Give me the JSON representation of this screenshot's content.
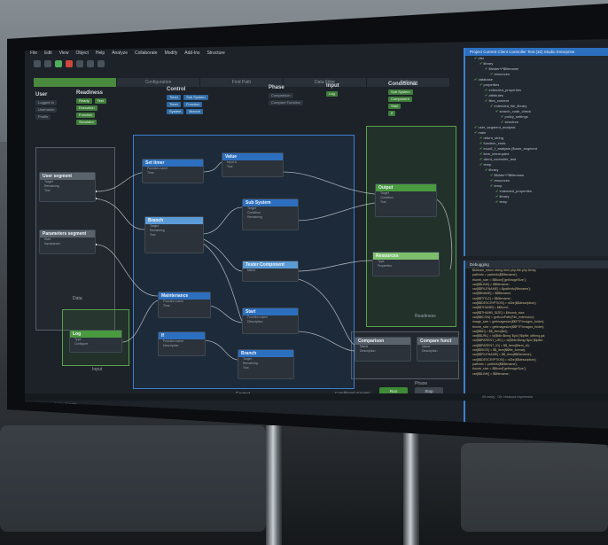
{
  "scene": {
    "description_note": "",
    "menu": [
      "File",
      "Edit",
      "View",
      "Object",
      "Help",
      "Analyze",
      "Collaborate",
      "Modify",
      "Add-Ins",
      "Structure"
    ],
    "tabs": [
      "",
      "Configuration",
      "Find Path",
      "Data Filter",
      "Settings"
    ],
    "groups": [
      {
        "title": "User",
        "chips": [
          "Logged In",
          "Username",
          "Profile"
        ]
      },
      {
        "title": "Readiness",
        "chips": [
          "Ready",
          "Execution",
          "Function",
          "Simulator",
          "Test"
        ]
      },
      {
        "title": "Control",
        "chips": [
          "Timer",
          "Timer",
          "Sub System",
          "Function",
          "System",
          "Branch"
        ]
      },
      {
        "title": "Phase",
        "chips": [
          "Comparison",
          "Compare Function"
        ]
      },
      {
        "title": "Input",
        "chips": [
          "Log"
        ]
      },
      {
        "title": "Conditional",
        "chips": [
          "Sub System",
          "Component",
          "Start",
          "If"
        ]
      }
    ],
    "nodes": {
      "user_segment": {
        "title": "User segment",
        "props": [
          "Target",
          "Remaining",
          "Tool"
        ]
      },
      "param_segment": {
        "title": "Parameters segment",
        "props": [
          "Start",
          "Inputparam"
        ]
      },
      "set_timer": {
        "title": "Set timer",
        "props": [
          "Function name",
          "Time"
        ]
      },
      "value": {
        "title": "Value",
        "props": [
          "Input A",
          "Tool"
        ]
      },
      "branch1": {
        "title": "Branch",
        "props": [
          "Target",
          "Remaining",
          "Tool"
        ]
      },
      "sub_system": {
        "title": "Sub System",
        "props": [
          "Target",
          "Condition",
          "Remaining"
        ]
      },
      "tester": {
        "title": "Tester Component",
        "props": [
          "Name"
        ]
      },
      "maintenance": {
        "title": "Maintenance",
        "props": [
          "Function name",
          "Time"
        ]
      },
      "start": {
        "title": "Start",
        "props": [
          "Function name",
          "Description"
        ]
      },
      "if_node": {
        "title": "If",
        "props": [
          "Function name",
          "Description"
        ]
      },
      "branch2": {
        "title": "Branch",
        "props": [
          "Target",
          "Remaining",
          "Tool"
        ]
      },
      "log": {
        "title": "Log",
        "props": [
          "Type",
          "Configure"
        ]
      },
      "output": {
        "title": "Output",
        "props": [
          "Target",
          "Condition",
          "Tool"
        ]
      },
      "resources": {
        "title": "Resources",
        "props": [
          "Type",
          "Properties"
        ]
      },
      "comparison": {
        "title": "Comparison",
        "props": [
          "Name",
          "Description"
        ]
      },
      "compare_func": {
        "title": "Compare funct",
        "props": [
          "Name",
          "Description"
        ]
      }
    },
    "zone_labels": {
      "data": "Data",
      "control": "Control",
      "readiness": "Readiness",
      "input": "Input",
      "phase": "Phase"
    },
    "conditional_process": "Conditional process:",
    "run_label": "Run",
    "stop_label": "Stop",
    "tree_header": "Project Current Client Controller Test (32) Studio Enterprise",
    "tree_items": [
      "dist",
      "library",
      "$folder*/*$filename",
      "resources",
      "database",
      "properties",
      "extended_properties",
      "attributes",
      "files_content",
      "extended_file_library",
      "search_code_check",
      "policy_settings",
      "structure",
      "user_segment_analysis",
      "main",
      "return_string",
      "function_ends",
      "local1_f_analysis ($user_segment",
      "item_interrupted",
      "client_controller_test",
      "temp",
      "library",
      "$folder*/*$filename",
      "resources",
      "temp",
      "extended_properties",
      "library",
      "temp"
    ],
    "code_header": "Debugging",
    "code_lines": [
      "$stream_return string html php-file-php Array;",
      "pathinfo = pathinfo($$filename);",
      "thumb_size = $$fconf['getImageSize'];",
      "var[$$LINK] = $$filename;",
      "var[$$FILENAME] = $pathinfo['filename'];",
      "var[$$NAME] = $$filename;",
      "var[$$TITLE] = $$filename;",
      "var[$$DESCRIPTION] = nl2br($$description);",
      "var[$$THUMB] = $$fconf;",
      "var[$$THUMB_SIZE] = $thumb_size;",
      "var[$$ICON] = getIconPath(File_extension);",
      "image_size = getImagesize($$FTP.Images_folder);",
      "thumb_size = getImagesize($$FTP.Images_folder);",
      "var[$$ID] = $$_item($id);",
      "var[$$URL] = id($fdb.$bmg.'$pic')'$ipfile_idfbmg.gd;",
      "var[$$PARENT_URL] = id($fdb.$bmg.'$pic')$ipfile;",
      "var[$$PARENT_ID] = $$_item($item_id);",
      "var[$$SIZE] = $$_item($$file_format);",
      "var[$$FILENAME] = $$_item($$filename);",
      "var[$$DESCRIPTION] = nl2br($$description);",
      "pathinfo = pathinfo($$filename);",
      "thumb_size = $$fconf['getImageSize'];",
      "var[$$LINK] = $$filename;"
    ],
    "status_left": "Line 28, Col 40 · Buffer: 32 bytes",
    "status_right": "Kit ready · Git: checkout experiment"
  }
}
